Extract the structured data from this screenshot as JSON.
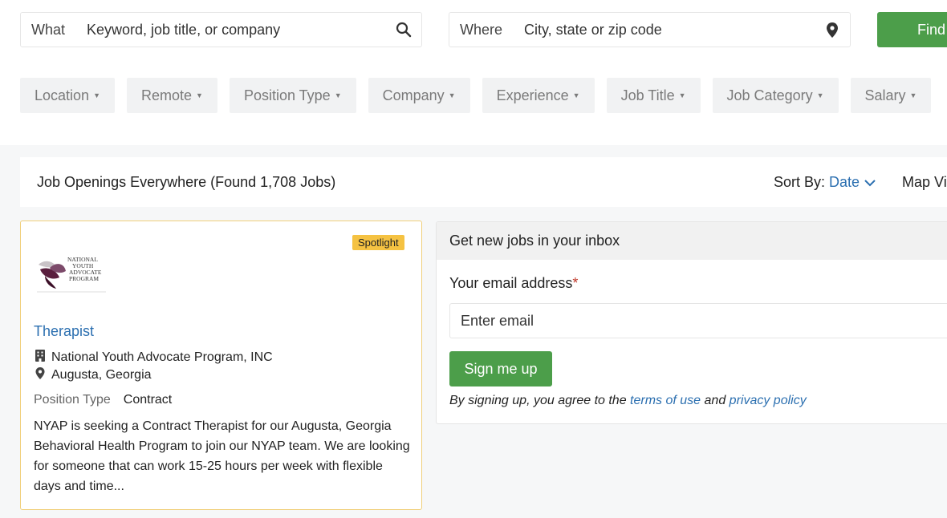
{
  "search": {
    "what_label": "What",
    "what_placeholder": "Keyword, job title, or company",
    "where_label": "Where",
    "where_placeholder": "City, state or zip code",
    "find_label": "Find"
  },
  "filters": [
    {
      "label": "Location"
    },
    {
      "label": "Remote"
    },
    {
      "label": "Position Type"
    },
    {
      "label": "Company"
    },
    {
      "label": "Experience"
    },
    {
      "label": "Job Title"
    },
    {
      "label": "Job Category"
    },
    {
      "label": "Salary"
    }
  ],
  "results": {
    "title": "Job Openings Everywhere (Found 1,708 Jobs)",
    "sort_label": "Sort By:",
    "sort_value": "Date",
    "map_view": "Map View"
  },
  "job": {
    "badge": "Spotlight",
    "logo_lines": [
      "NATIONAL",
      "YOUTH",
      "ADVOCATE",
      "PROGRAM"
    ],
    "title": "Therapist",
    "company": "National Youth Advocate Program, INC",
    "location": "Augusta, Georgia",
    "position_type_label": "Position Type",
    "position_type_value": "Contract",
    "description": "NYAP is seeking a Contract Therapist for our Augusta, Georgia Behavioral Health Program to join our NYAP team. We are looking for someone that can work 15-25 hours per week with flexible days and time..."
  },
  "signup": {
    "header": "Get new jobs in your inbox",
    "email_label": "Your email address",
    "required_mark": "*",
    "email_placeholder": "Enter email",
    "button_label": "Sign me up",
    "terms_prefix": "By signing up, you agree to the ",
    "terms_link": "terms of use",
    "terms_mid": " and ",
    "privacy_link": "privacy policy"
  },
  "colors": {
    "accent_green": "#4c9e4a",
    "link_blue": "#2b6fb0",
    "spotlight_yellow": "#f5c242"
  }
}
